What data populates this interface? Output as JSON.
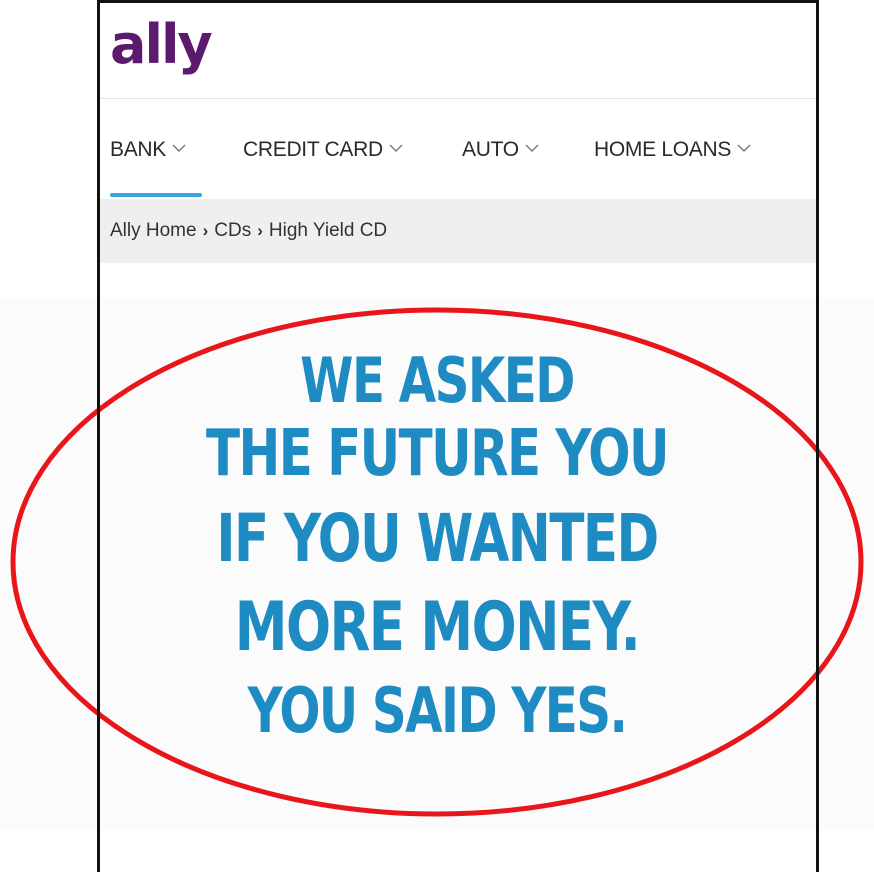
{
  "brand": {
    "logo_text": "ally",
    "logo_color": "#5b1a6e"
  },
  "nav": {
    "items": [
      {
        "label": "BANK"
      },
      {
        "label": "CREDIT CARD"
      },
      {
        "label": "AUTO"
      },
      {
        "label": "HOME LOANS"
      }
    ],
    "active_index": 0,
    "active_color": "#3aa5dd"
  },
  "breadcrumb": {
    "items": [
      "Ally Home",
      "CDs",
      "High Yield CD"
    ],
    "separator": "›"
  },
  "hero": {
    "lines": [
      "WE ASKED",
      "THE FUTURE YOU",
      "IF YOU WANTED",
      "MORE MONEY.",
      "YOU SAID YES."
    ],
    "text_color": "#1e8bc3",
    "annotation_color": "#e8161b"
  }
}
